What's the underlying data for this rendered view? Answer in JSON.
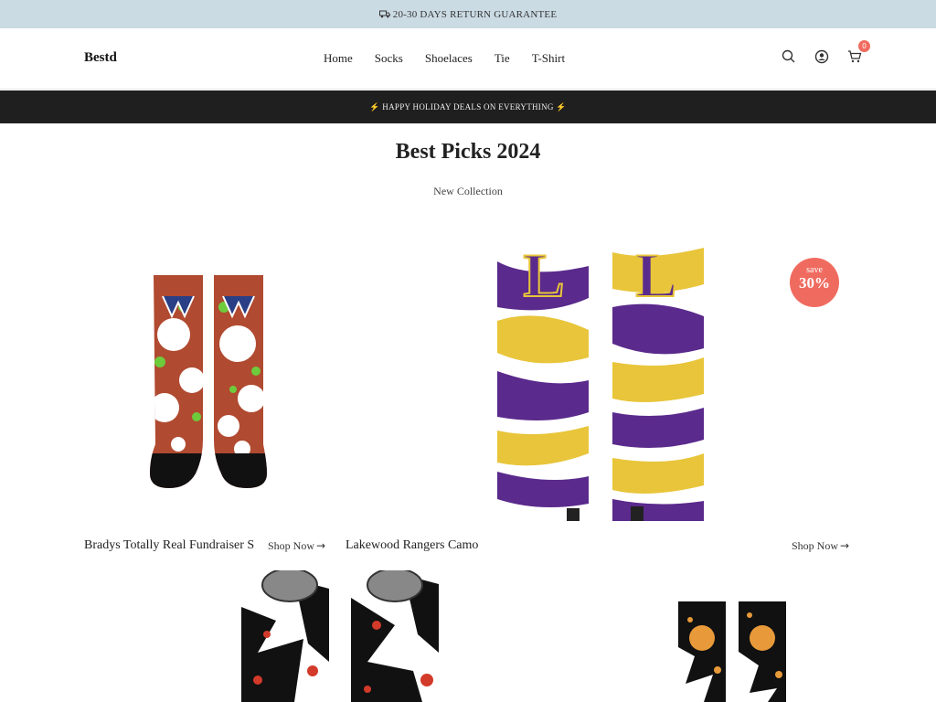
{
  "announcement": {
    "text": "20-30 DAYS RETURN GUARANTEE",
    "icon": "truck-icon"
  },
  "header": {
    "logo": "Bestd",
    "nav": [
      "Home",
      "Socks",
      "Shoelaces",
      "Tie",
      "T-Shirt"
    ],
    "cart_count": "0"
  },
  "promo": {
    "text": "⚡ HAPPY HOLIDAY DEALS ON EVERYTHING ⚡"
  },
  "section": {
    "title": "Best Picks 2024",
    "subtitle": "New Collection"
  },
  "products": [
    {
      "name": "Bradys Totally Real Fundraiser S",
      "cta": "Shop Now",
      "colors": [
        "#b04a30",
        "#6ecb3c",
        "#ffffff"
      ]
    },
    {
      "name": "Lakewood Rangers Camo",
      "cta": "Shop Now",
      "badge_top": "save",
      "badge_value": "30%",
      "colors": [
        "#5a2a8c",
        "#e8c53a",
        "#ffffff"
      ]
    },
    {
      "colors": [
        "#111111",
        "#d23a2a",
        "#ffffff"
      ]
    },
    {
      "colors": [
        "#111111",
        "#e89a3a",
        "#ffffff"
      ]
    }
  ],
  "theme": {
    "accent": "#f06b5f",
    "topbar": "#cbdbe4",
    "promo_bg": "#1f1f1f"
  }
}
